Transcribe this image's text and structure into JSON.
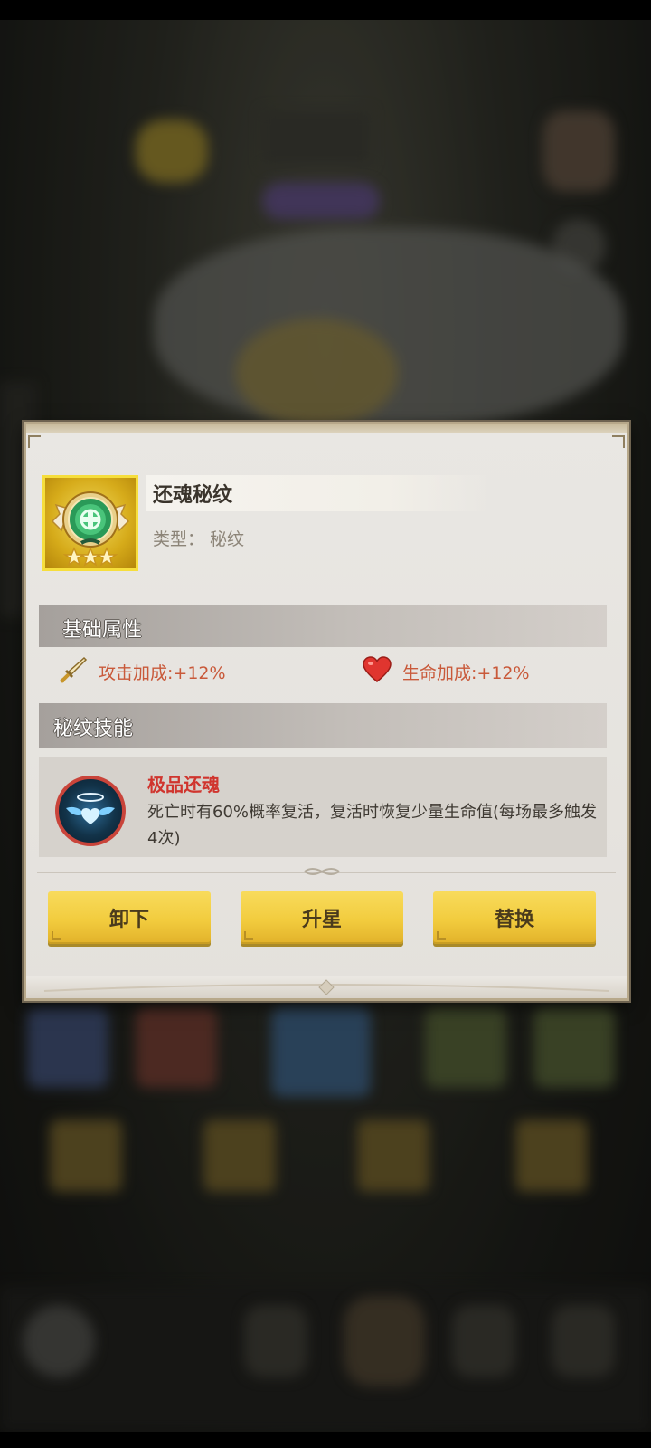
{
  "item": {
    "name": "还魂秘纹",
    "type_text": "类型：  秘纹",
    "stars": 3,
    "icon": "rune-emblem-icon"
  },
  "basic_attributes": {
    "title": "基础属性",
    "items": [
      {
        "icon": "sword-icon",
        "label": "攻击加成:+12%"
      },
      {
        "icon": "heart-icon",
        "label": "生命加成:+12%"
      }
    ]
  },
  "rune_skill": {
    "title": "秘纹技能",
    "skill_name": "极品还魂",
    "skill_icon": "winged-heart-halo-icon",
    "description": "死亡时有60%概率复活，复活时恢复少量生命值(每场最多触发4次)"
  },
  "buttons": {
    "unequip": "卸下",
    "upgrade_star": "升星",
    "replace": "替换"
  },
  "colors": {
    "accent_red": "#d0352e",
    "attribute_text": "#c9593a",
    "button_yellow": "#f2cc3e",
    "icon_frame_yellow": "#f6de3c"
  }
}
